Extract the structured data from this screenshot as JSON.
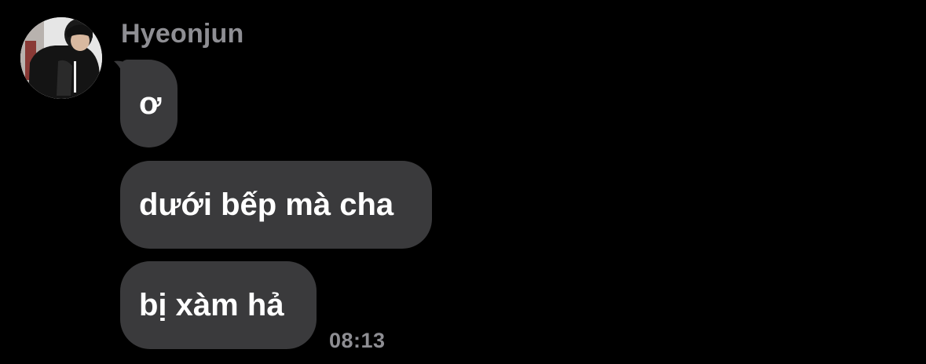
{
  "conversation": {
    "sender_name": "Hyeonjun",
    "messages": [
      {
        "text": "ơ"
      },
      {
        "text": "dưới bếp mà cha"
      },
      {
        "text": "bị xàm hả"
      }
    ],
    "last_timestamp": "08:13"
  },
  "icons": {
    "avatar": "profile-photo-avatar"
  },
  "colors": {
    "background": "#000000",
    "bubble": "#3a3a3c",
    "message_text": "#ffffff",
    "meta_text": "#8e8e93"
  }
}
